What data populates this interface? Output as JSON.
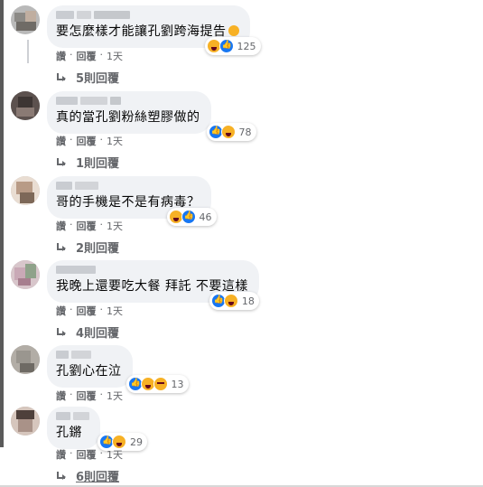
{
  "comments": [
    {
      "text": "要怎麼樣才能讓孔劉跨海提告",
      "has_inline_emoji": true,
      "reactions": {
        "icons": [
          "haha-icon",
          "like-icon"
        ],
        "count": "125"
      },
      "meta": {
        "like": "讚",
        "reply": "回覆",
        "time": "1天"
      },
      "replies_label": "5則回覆",
      "avatar_colors": [
        "#8c8a86",
        "#c0aea0",
        "#6f6b66",
        "#d9cfc5"
      ]
    },
    {
      "text": "真的當孔劉粉絲塑膠做的",
      "has_inline_emoji": false,
      "reactions": {
        "icons": [
          "like-icon",
          "haha-icon"
        ],
        "count": "78"
      },
      "meta": {
        "like": "讚",
        "reply": "回覆",
        "time": "1天"
      },
      "replies_label": "1則回覆",
      "avatar_colors": [
        "#3d3533",
        "#8a7a74",
        "#c8c0bb",
        "#5c514e"
      ]
    },
    {
      "text": "哥的手機是不是有病毒？",
      "has_inline_emoji": false,
      "reactions": {
        "icons": [
          "haha-icon",
          "like-icon"
        ],
        "count": "46"
      },
      "meta": {
        "like": "讚",
        "reply": "回覆",
        "time": "1天"
      },
      "replies_label": "2則回覆",
      "avatar_colors": [
        "#b89b86",
        "#d8c2b0",
        "#7d6858",
        "#e9ddd2"
      ]
    },
    {
      "text": "我晚上還要吃大餐 拜託 不要這樣",
      "has_inline_emoji": false,
      "reactions": {
        "icons": [
          "like-icon",
          "haha-icon"
        ],
        "count": "18"
      },
      "meta": {
        "like": "讚",
        "reply": "回覆",
        "time": "1天"
      },
      "replies_label": "4則回覆",
      "avatar_colors": [
        "#c9a9b6",
        "#8fa28a",
        "#d8c6cb",
        "#a77e8e"
      ]
    },
    {
      "text": "孔劉心在泣",
      "has_inline_emoji": false,
      "reactions": {
        "icons": [
          "like-icon",
          "haha-icon",
          "sad-icon"
        ],
        "count": "13"
      },
      "meta": {
        "like": "讚",
        "reply": "回覆",
        "time": "1天"
      },
      "replies_label": "",
      "avatar_colors": [
        "#9a968f",
        "#c8c4bd",
        "#6e6a64",
        "#b2ada6"
      ]
    },
    {
      "text": "孔鏘",
      "has_inline_emoji": false,
      "reactions": {
        "icons": [
          "like-icon",
          "haha-icon"
        ],
        "count": "29"
      },
      "meta": {
        "like": "讚",
        "reply": "回覆",
        "time": "1天"
      },
      "replies_label": "6則回覆",
      "avatar_colors": [
        "#6e5c55",
        "#a99288",
        "#d6c6bd",
        "#4e403b"
      ]
    }
  ]
}
